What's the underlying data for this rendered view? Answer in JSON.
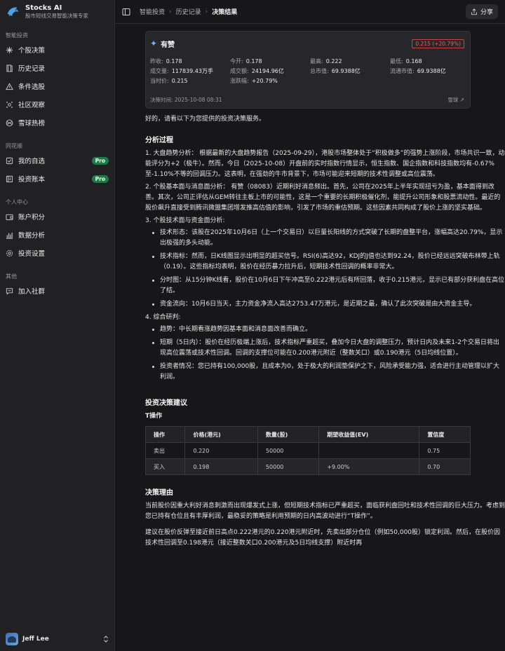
{
  "app": {
    "title": "Stocks AI",
    "subtitle": "股市短线交易智能决策专家"
  },
  "sidebar": {
    "sections": [
      {
        "label": "智能投资",
        "items": [
          {
            "label": "个股决策",
            "icon": "sparkle-icon"
          },
          {
            "label": "历史记录",
            "icon": "book-icon"
          },
          {
            "label": "条件选股",
            "icon": "triangle-icon"
          },
          {
            "label": "社区观察",
            "icon": "community-icon"
          },
          {
            "label": "雪球热榜",
            "icon": "globe-icon"
          }
        ]
      },
      {
        "label": "同花顺",
        "items": [
          {
            "label": "我的自选",
            "icon": "checklist-icon",
            "badge": "Pro"
          },
          {
            "label": "投资账本",
            "icon": "ledger-icon",
            "badge": "Pro"
          }
        ]
      },
      {
        "label": "个人中心",
        "items": [
          {
            "label": "账户积分",
            "icon": "wallet-icon"
          },
          {
            "label": "数据分析",
            "icon": "bar-chart-icon"
          },
          {
            "label": "投资设置",
            "icon": "settings-icon"
          }
        ]
      },
      {
        "label": "其他",
        "items": [
          {
            "label": "加入社群",
            "icon": "chat-icon"
          }
        ]
      }
    ],
    "user": {
      "name": "Jeff Lee"
    }
  },
  "header": {
    "breadcrumb": [
      "智能投资",
      "历史记录",
      "决策结果"
    ],
    "share_label": "分享"
  },
  "stock": {
    "name": "有赞",
    "change": "0.215 (+20.79%)",
    "stats": [
      [
        "昨收:",
        "0.178"
      ],
      [
        "今开:",
        "0.178"
      ],
      [
        "最高:",
        "0.222"
      ],
      [
        "最低:",
        "0.168"
      ],
      [
        "成交量:",
        "117839.43万手"
      ],
      [
        "成交额:",
        "24194.96亿"
      ],
      [
        "总市值:",
        "69.9388亿"
      ],
      [
        "流通市值:",
        "69.9388亿"
      ],
      [
        "当时价:",
        "0.215"
      ],
      [
        "涨跌幅:",
        "+20.79%"
      ]
    ],
    "time": "决策时间: 2025-10-08 08:31",
    "source": "雪球 ↗"
  },
  "report": {
    "intro": "好的，请看以下为您提供的投资决策服务。",
    "analysis_title": "分析过程",
    "p1": "1. 大盘趋势分析： 根据最新的大盘趋势报告（2025-09-29），港股市场整体处于“积极做多”的强势上涨阶段，市场共识一致，动能评分为+2（极牛）。然而，今日（2025-10-08）开盘前的实时指数行情显示，恒生指数、国企指数和科技指数均有-0.67%至-1.10%不等的回调压力。这表明，在强劲的牛市背景下，市场可能迎来短期的技术性调整或高位震荡。",
    "p2": "2. 个股基本面与消息面分析： 有赞（08083）近期利好消息频出。首先，公司在2025年上半年实现扭亏为盈，基本面得到改善。其次，公司正评估从GEM转往主板上市的可能性，这是一个重要的长期积极催化剂，能提升公司形象和股票流动性。最近的股价飙升直接受到腾讯微盟集团增发推高估值的影响，引发了市场的重估预期。这些因素共同构成了股价上涨的坚实基础。",
    "p3": "3. 个股技术面与资金面分析:",
    "p3_items": [
      "技术形态：该股在2025年10月6日（上一个交易日）以巨量长阳线的方式突破了长期的盘整平台，涨幅高达20.79%，显示出极强的多头动能。",
      "技术指标：然而，日K线图显示出明显的超买信号。RSI(6)高达92，KDJ的J值也达到92.24，股价已经远远突破布林带上轨（0.19）。这些指标均表明，股价在经历暴力拉升后，短期技术性回调的概率非常大。",
      "分时图：从15分钟K线看，股价在10月6日下午冲高至0.222港元后有所回落，收于0.215港元，显示已有部分获利盘在高位了结。",
      "资金流向：10月6日当天，主力资金净流入高达2753.47万港元，是近期之最，确认了此次突破是由大资金主导。"
    ],
    "p4": "4. 综合研判:",
    "p4_items": [
      "趋势：中长期看涨趋势因基本面和消息面改善而确立。",
      "短期（5日内）：股价在经历极端上涨后，技术指标严重超买，叠加今日大盘的调整压力，预计日内及未来1-2个交易日将出现高位震荡或技术性回调。回调的支撑位可能在0.200港元附近（整数关口）或0.190港元（5日均线位置）。",
      "投资者情况：您已持有100,000股，且成本为0，处于极大的利润垫保护之下，风险承受能力强，适合进行主动管理以扩大利润。"
    ],
    "advice_title": "投资决策建议",
    "t_title": "T操作",
    "table": {
      "headers": [
        "操作",
        "价格(港元)",
        "数量(股)",
        "期望收益值(EV)",
        "置信度"
      ],
      "rows": [
        [
          "卖出",
          "0.220",
          "50000",
          "",
          "0.75"
        ],
        [
          "买入",
          "0.198",
          "50000",
          "+9.00%",
          "0.70"
        ]
      ]
    },
    "reason_title": "决策理由",
    "reason1": "当前股价因重大利好消息刺激而出现爆发式上涨，但短期技术指标已严重超买，面临获利盘回吐和技术性回调的巨大压力。考虑到您已持有仓位且有丰厚利润，最稳妥的策略是利用预期的日内高波动进行“T操作”。",
    "reason2": "建议在股价反弹至接近前日高点0.222港元的0.220港元附近时，先卖出部分仓位（例如50,000股）锁定利润。然后，在股价因技术性回调至0.198港元（接近整数关口0.200港元及5日均线支撑）附近时再"
  }
}
